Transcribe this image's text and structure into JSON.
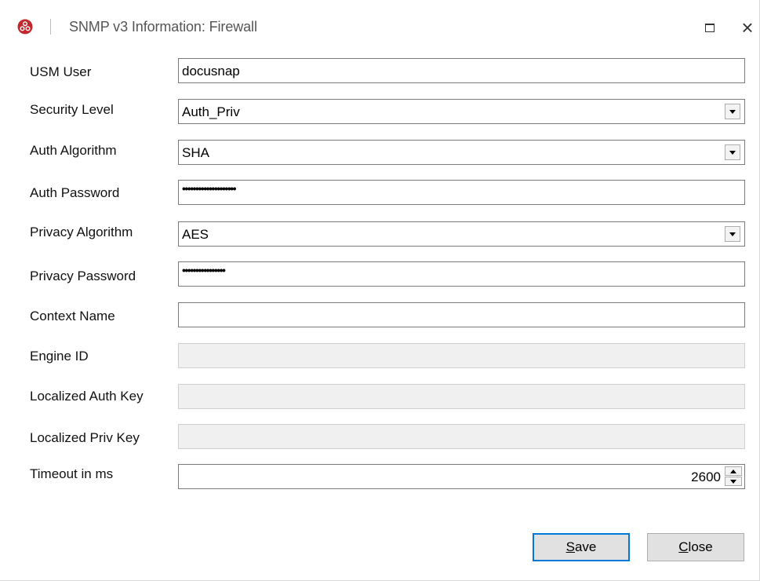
{
  "window": {
    "title": "SNMP v3 Information: Firewall",
    "icon": "app-logo-icon",
    "controls": [
      "maximize-icon",
      "close-icon"
    ]
  },
  "form": {
    "usm_user": {
      "label": "USM User",
      "value": "docusnap"
    },
    "security_level": {
      "label": "Security Level",
      "value": "Auth_Priv"
    },
    "auth_algorithm": {
      "label": "Auth Algorithm",
      "value": "SHA"
    },
    "auth_password": {
      "label": "Auth Password",
      "value": "••••••••••••••••••••"
    },
    "privacy_algorithm": {
      "label": "Privacy Algorithm",
      "value": "AES"
    },
    "privacy_password": {
      "label": "Privacy Password",
      "value": "••••••••••••••••"
    },
    "context_name": {
      "label": "Context Name",
      "value": ""
    },
    "engine_id": {
      "label": "Engine ID",
      "value": ""
    },
    "localized_auth_key": {
      "label": "Localized Auth Key",
      "value": ""
    },
    "localized_priv_key": {
      "label": "Localized Priv Key",
      "value": ""
    },
    "timeout": {
      "label": "Timeout in ms",
      "value": "2600"
    }
  },
  "buttons": {
    "save": {
      "first": "S",
      "rest": "ave"
    },
    "close": {
      "first": "C",
      "rest": "lose"
    }
  },
  "colors": {
    "default_button_border": "#0078d7",
    "button_face": "#e1e1e1",
    "disabled_field": "#f0f0f0",
    "logo_red": "#c0282e"
  }
}
